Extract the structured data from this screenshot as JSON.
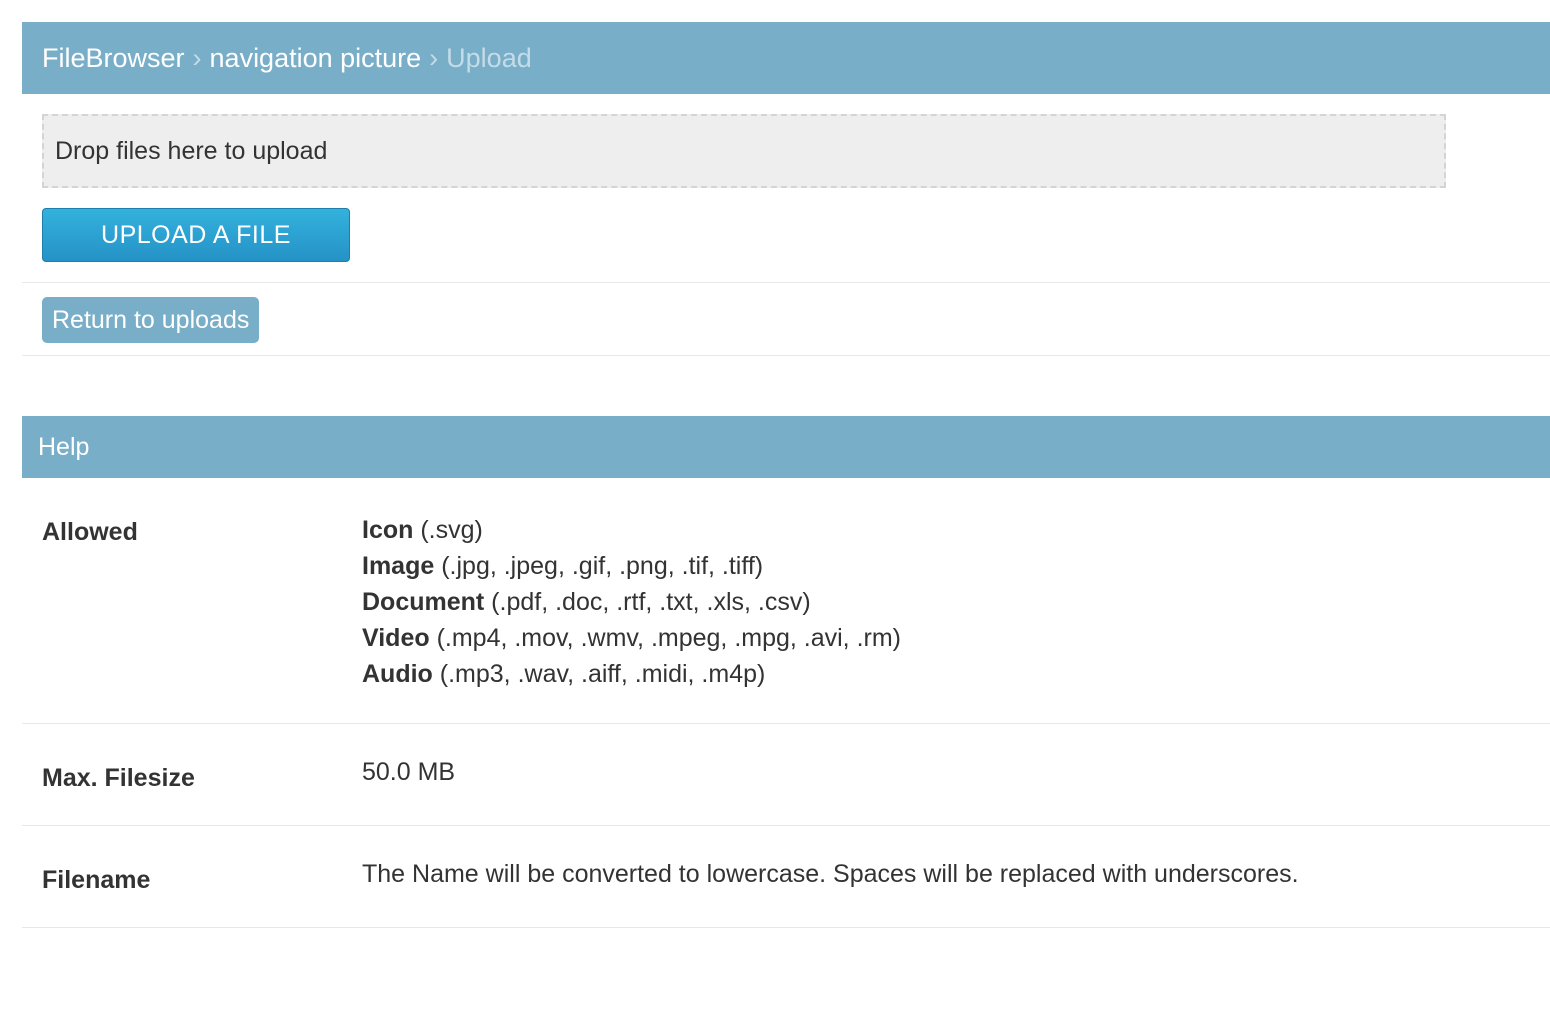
{
  "breadcrumbs": {
    "root": "FileBrowser",
    "separator": "›",
    "folder": "navigation picture",
    "current": "Upload"
  },
  "upload": {
    "dropzone_text": "Drop files here to upload",
    "button_label": "UPLOAD A FILE",
    "return_label": "Return to uploads"
  },
  "help": {
    "title": "Help",
    "allowed": {
      "label": "Allowed",
      "types": [
        {
          "name": "Icon",
          "ext": " (.svg)"
        },
        {
          "name": "Image",
          "ext": " (.jpg, .jpeg, .gif, .png, .tif, .tiff)"
        },
        {
          "name": "Document",
          "ext": " (.pdf, .doc, .rtf, .txt, .xls, .csv)"
        },
        {
          "name": "Video",
          "ext": " (.mp4, .mov, .wmv, .mpeg, .mpg, .avi, .rm)"
        },
        {
          "name": "Audio",
          "ext": " (.mp3, .wav, .aiff, .midi, .m4p)"
        }
      ]
    },
    "max_filesize": {
      "label": "Max. Filesize",
      "value": "50.0 MB"
    },
    "filename": {
      "label": "Filename",
      "value": "The Name will be converted to lowercase. Spaces will be replaced with underscores."
    }
  },
  "colors": {
    "header_bg": "#79aec8",
    "upload_button": "#2aa3d3",
    "dropzone_bg": "#eeeeee"
  }
}
